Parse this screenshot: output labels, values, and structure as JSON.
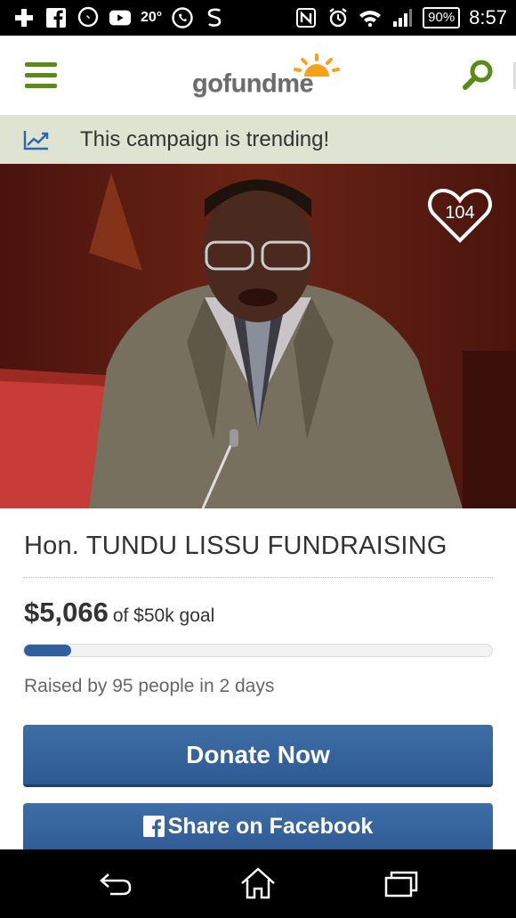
{
  "status_bar": {
    "temperature": "20°",
    "battery": "90%",
    "time": "8:57",
    "icons": [
      "plus-icon",
      "facebook-icon",
      "messenger-icon",
      "youtube-icon",
      "whatsapp-icon",
      "s-icon",
      "nfc-icon",
      "alarm-icon",
      "wifi-icon",
      "signal-icon"
    ]
  },
  "header": {
    "logo_text_a": "gofund",
    "logo_text_b": "me",
    "menu_icon": "hamburger-icon",
    "search_icon": "search-icon"
  },
  "trending": {
    "text": "This campaign is trending!",
    "icon": "trending-chart-icon"
  },
  "hero": {
    "like_count": "104",
    "heart_icon": "heart-icon"
  },
  "campaign": {
    "title": "Hon. TUNDU LISSU FUNDRAISING",
    "raised_amount": "$5,066",
    "goal_text": "of $50k goal",
    "progress_fraction": 0.1013,
    "raised_by": "Raised by 95 people in 2 days"
  },
  "actions": {
    "donate_label": "Donate Now",
    "facebook_label": "Share on Facebook"
  },
  "colors": {
    "brand_green": "#5b8a16",
    "button_blue": "#34629c",
    "trending_bg": "#dfe4d2"
  },
  "nav": {
    "back_icon": "back-icon",
    "home_icon": "home-icon",
    "recents_icon": "recent-apps-icon"
  }
}
